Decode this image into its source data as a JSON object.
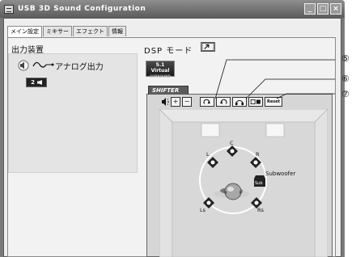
{
  "window": {
    "title": "USB 3D Sound Configuration",
    "buttons": [
      "minimize",
      "maximize",
      "close"
    ]
  },
  "tabs": [
    {
      "label": "メイン設定",
      "active": true
    },
    {
      "label": "ミキサー",
      "active": false
    },
    {
      "label": "エフェクト",
      "active": false
    },
    {
      "label": "情報",
      "active": false
    }
  ],
  "output": {
    "section_title": "出力装置",
    "device_label": "アナログ出力",
    "channel_button": "2"
  },
  "dsp": {
    "label": "DSP モード",
    "virtual_button": {
      "line1": "5.1",
      "line2": "Virtual",
      "line3": "SURROUND"
    }
  },
  "shifter": {
    "tab_label": "SHIFTER",
    "reset_label": "Reset"
  },
  "speakers": {
    "c": "C",
    "l": "L",
    "r": "R",
    "ls": "Ls",
    "rs": "Rs",
    "sub_tag": "Sub",
    "subwoofer": "Subwoofer"
  },
  "callouts": [
    "⑤",
    "⑥",
    "⑦"
  ],
  "colors": {
    "titlebar": "#6e6e6e",
    "speaker_dark": "#222222"
  }
}
